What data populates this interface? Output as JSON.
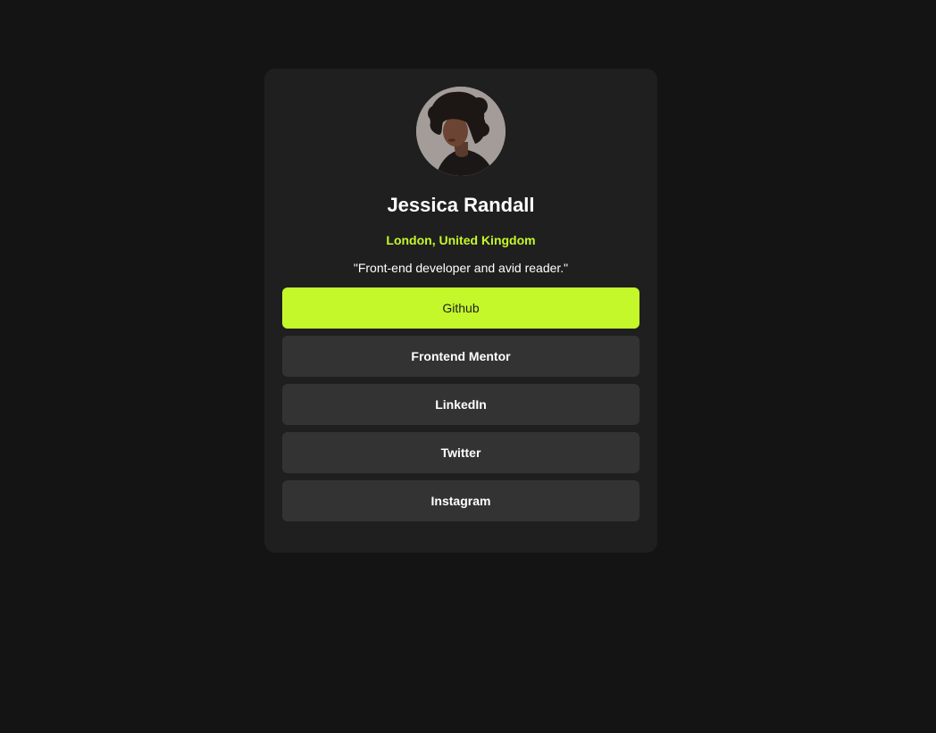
{
  "profile": {
    "name": "Jessica Randall",
    "location": "London, United Kingdom",
    "bio": "\"Front-end developer and avid reader.\"",
    "avatar_alt": "Jessica Randall"
  },
  "links": [
    {
      "label": "Github",
      "active": true
    },
    {
      "label": "Frontend Mentor",
      "active": false
    },
    {
      "label": "LinkedIn",
      "active": false
    },
    {
      "label": "Twitter",
      "active": false
    },
    {
      "label": "Instagram",
      "active": false
    }
  ],
  "colors": {
    "background": "#141414",
    "card": "#1f1f1f",
    "button": "#333333",
    "accent": "#c4f82a",
    "text": "#ffffff"
  }
}
